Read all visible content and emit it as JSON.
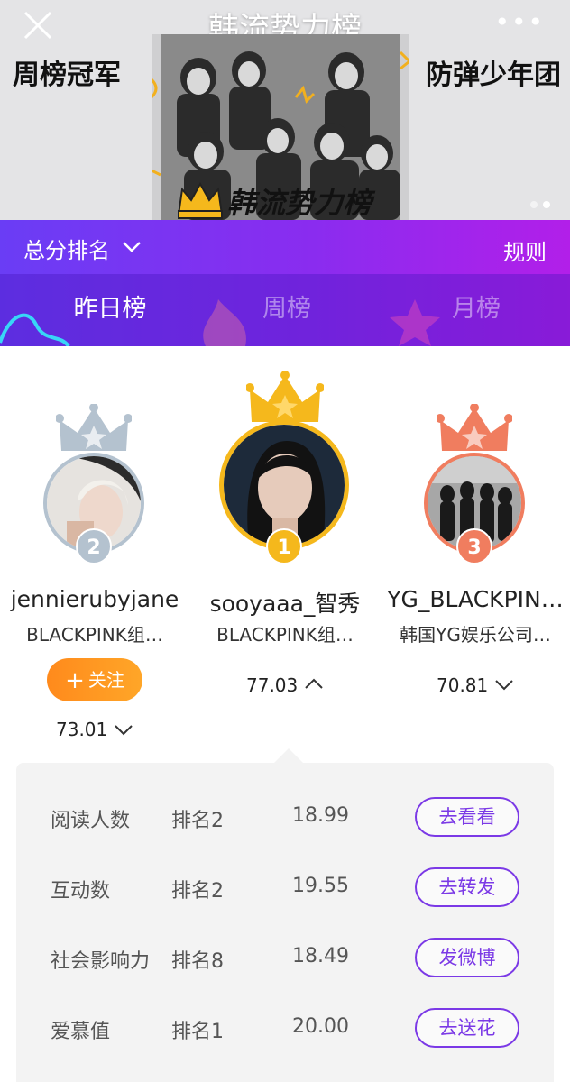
{
  "banner": {
    "title": "韩流势力榜",
    "left_label": "周榜冠军",
    "right_label": "防弹少年团",
    "logo_text": "韩流势力榜",
    "more_icon": "more-dots-icon",
    "close_icon": "close-icon"
  },
  "header": {
    "sort_label": "总分排名",
    "rules_label": "规则",
    "tabs": [
      {
        "label": "昨日榜",
        "active": true
      },
      {
        "label": "周榜",
        "active": false
      },
      {
        "label": "月榜",
        "active": false
      }
    ]
  },
  "podium": {
    "second": {
      "rank": "2",
      "name": "jennierubyjane",
      "subtitle": "BLACKPINK组…",
      "follow_label": "关注",
      "score": "73.01",
      "trend": "down"
    },
    "first": {
      "rank": "1",
      "name": "sooyaaa_智秀",
      "subtitle": "BLACKPINK组…",
      "score": "77.03",
      "trend": "up"
    },
    "third": {
      "rank": "3",
      "name": "YG_BLACKPIN…",
      "subtitle": "韩国YG娱乐公司…",
      "score": "70.81",
      "trend": "down"
    }
  },
  "details": [
    {
      "metric": "阅读人数",
      "rank": "排名2",
      "value": "18.99",
      "action": "去看看"
    },
    {
      "metric": "互动数",
      "rank": "排名2",
      "value": "19.55",
      "action": "去转发"
    },
    {
      "metric": "社会影响力",
      "rank": "排名8",
      "value": "18.49",
      "action": "发微博"
    },
    {
      "metric": "爱慕值",
      "rank": "排名1",
      "value": "20.00",
      "action": "去送花"
    }
  ],
  "colors": {
    "accent": "#7b39e6",
    "gold": "#f5b81c",
    "silver": "#b4c2cf",
    "bronze": "#f07d5f",
    "follow": "#ff8a1c"
  }
}
